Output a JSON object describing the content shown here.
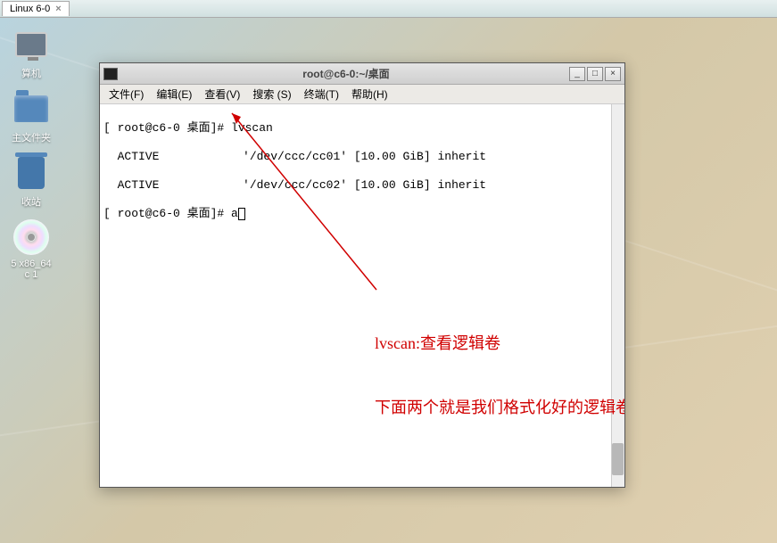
{
  "vm_tab": {
    "label": "Linux 6-0",
    "close": "×"
  },
  "desktop": {
    "computer": "算机",
    "home": "主文件夹",
    "trash": "收站",
    "dvd_line1": "5 x86_64",
    "dvd_line2": "c 1"
  },
  "window": {
    "title": "root@c6-0:~/桌面",
    "minimize": "_",
    "maximize": "□",
    "close": "×"
  },
  "menu": {
    "file": "文件(F)",
    "edit": "编辑(E)",
    "view": "查看(V)",
    "search": "搜索 (S)",
    "terminal": "终端(T)",
    "help": "帮助(H)"
  },
  "terminal": {
    "line1": "[ root@c6-0 桌面]# lvscan",
    "line2": "  ACTIVE            '/dev/ccc/cc01' [10.00 GiB] inherit",
    "line3": "  ACTIVE            '/dev/ccc/cc02' [10.00 GiB] inherit",
    "line4_prompt": "[ root@c6-0 桌面]# a"
  },
  "annotation": {
    "line1": "lvscan:查看逻辑卷",
    "line2": "下面两个就是我们格式化好的逻辑卷"
  }
}
